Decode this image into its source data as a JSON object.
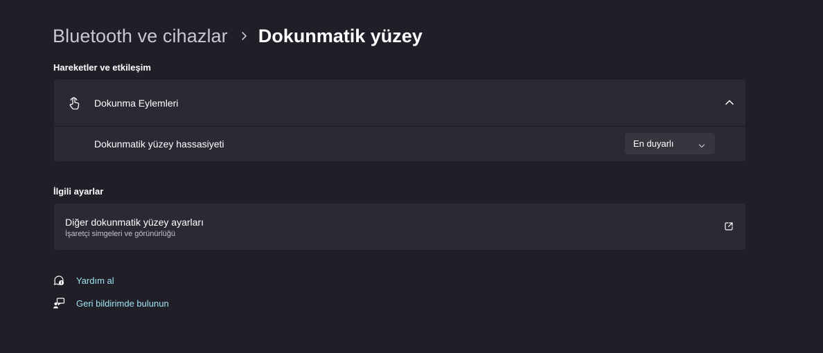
{
  "breadcrumb": {
    "parent": "Bluetooth ve cihazlar",
    "current": "Dokunmatik yüzey"
  },
  "sections": {
    "gestures_title": "Hareketler ve etkileşim",
    "related_title": "İlgili ayarlar"
  },
  "tap_actions": {
    "label": "Dokunma Eylemleri",
    "icon": "touch-hand-icon",
    "expanded": true,
    "sensitivity": {
      "label": "Dokunmatik yüzey hassasiyeti",
      "selected": "En duyarlı"
    }
  },
  "related": {
    "title": "Diğer dokunmatik yüzey ayarları",
    "subtitle": "İşaretçi simgeleri ve görünürlüğü",
    "icon": "external-link-icon"
  },
  "links": {
    "help": "Yardım al",
    "feedback": "Geri bildirimde bulunun"
  },
  "colors": {
    "background": "#201e26",
    "card": "#2b2933",
    "link": "#9fe3f2"
  }
}
